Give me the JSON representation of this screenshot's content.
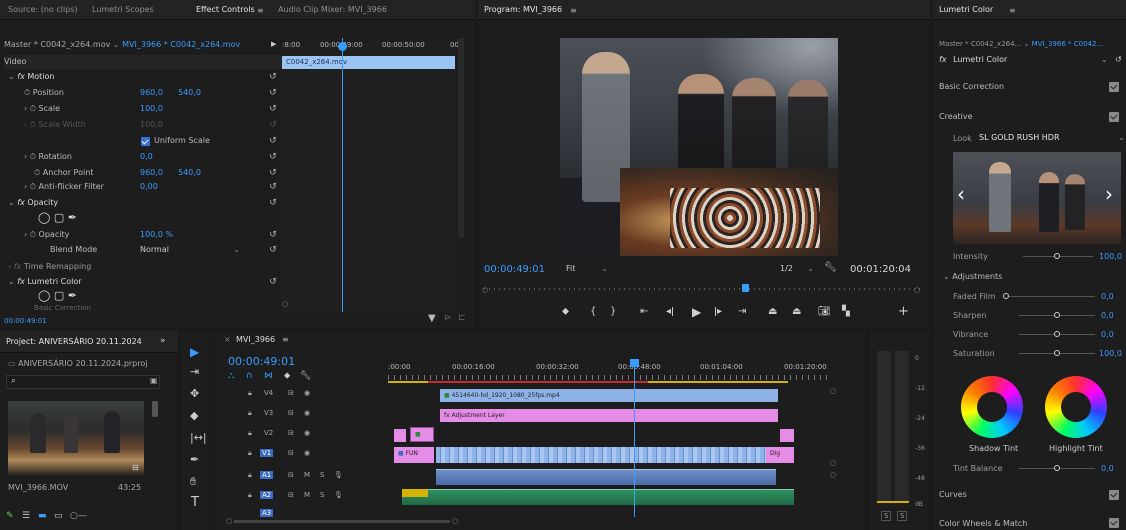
{
  "source_panel": {
    "tabs": [
      "Source: (no clips)",
      "Lumetri Scopes",
      "Effect Controls",
      "Audio Clip Mixer: MVI_3966"
    ],
    "master_label": "Master * C0042_x264.mov",
    "sequence_clip": "MVI_3966 * C0042_x264.mov",
    "ruler_times": [
      ":8:00",
      "00:00:49:00",
      "00:00:50:00",
      "00"
    ],
    "clip_name": "C0042_x264.mov",
    "section_video": "Video",
    "motion": "Motion",
    "position": {
      "label": "Position",
      "x": "960,0",
      "y": "540,0"
    },
    "scale": {
      "label": "Scale",
      "value": "100,0"
    },
    "scale_width": {
      "label": "Scale Width",
      "value": "100,0"
    },
    "uniform_scale": "Uniform Scale",
    "rotation": {
      "label": "Rotation",
      "value": "0,0"
    },
    "anchor": {
      "label": "Anchor Point",
      "x": "960,0",
      "y": "540,0"
    },
    "antiflicker": {
      "label": "Anti-flicker Filter",
      "value": "0,00"
    },
    "opacity_fx": "Opacity",
    "opacity": {
      "label": "Opacity",
      "value": "100,0 %"
    },
    "blend": {
      "label": "Blend Mode",
      "value": "Normal"
    },
    "time_remap": "Time Remapping",
    "lumetri": "Lumetri Color",
    "basic_correction": "Basic Correction",
    "timecode": "00:00:49:01"
  },
  "program": {
    "title": "Program: MVI_3966",
    "timecode": "00:00:49:01",
    "fit": "Fit",
    "quality": "1/2",
    "duration": "00:01:20:04"
  },
  "lumetri": {
    "title": "Lumetri Color",
    "master": "Master * C0042_x264...",
    "seq": "MVI_3966 * C0042...",
    "fx_name": "Lumetri Color",
    "basic_correction": "Basic Correction",
    "creative": "Creative",
    "look_label": "Look",
    "look_value": "SL GOLD RUSH HDR",
    "intensity": {
      "label": "Intensity",
      "value": "100,0"
    },
    "adjustments": "Adjustments",
    "faded_film": {
      "label": "Faded Film",
      "value": "0,0"
    },
    "sharpen": {
      "label": "Sharpen",
      "value": "0,0"
    },
    "vibrance": {
      "label": "Vibrance",
      "value": "0,0"
    },
    "saturation": {
      "label": "Saturation",
      "value": "100,0"
    },
    "shadow_tint": "Shadow Tint",
    "highlight_tint": "Highlight Tint",
    "tint_balance": {
      "label": "Tint Balance",
      "value": "0,0"
    },
    "curves": "Curves",
    "color_wheels": "Color Wheels & Match"
  },
  "project": {
    "title": "Project: ANIVERSÁRIO 20.11.2024",
    "file": "ANIVERSÁRIO 20.11.2024.prproj",
    "clip_name": "MVI_3966.MOV",
    "clip_duration": "43:25"
  },
  "timeline": {
    "tab": "MVI_3966",
    "timecode": "00:00:49:01",
    "ruler": [
      ":00:00",
      "00:00:16:00",
      "00:00:32:00",
      "00:00:48:00",
      "00:01:04:00",
      "00:01:20:00"
    ],
    "tracks_video": [
      "V4",
      "V3",
      "V2",
      "V1"
    ],
    "tracks_audio": [
      "A1",
      "A2",
      "A3"
    ],
    "clip_v4": "4514640-hd_1920_1080_25fps.mp4",
    "clip_v3": "Adjustment Layer",
    "clip_v1a": "FUN",
    "clip_v1b": "Dig",
    "track_m": "M",
    "track_s": "S",
    "meter_labels": [
      "0",
      "-12",
      "-24",
      "-36",
      "-48",
      "dB"
    ],
    "meter_bottom": [
      "S",
      "S"
    ]
  },
  "colors": {
    "accent": "#3b9cff",
    "pink": "#e58ce6",
    "lightblue": "#8fb3e8",
    "green": "#2f8f62"
  }
}
